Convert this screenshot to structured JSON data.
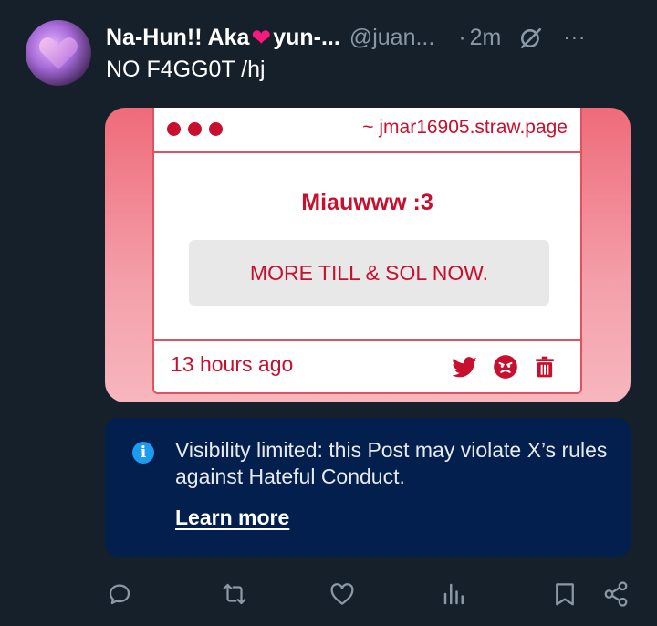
{
  "post": {
    "display_name": "Na-Hun!! Aka",
    "display_name_heart": "❤",
    "display_name_rest": "yun-...",
    "handle": "@juan...",
    "separator": "·",
    "time": "2m",
    "more": "···",
    "text": "NO F4GG0T /hj"
  },
  "card": {
    "url": "~ jmar16905.straw.page",
    "title": "Miauwww :3",
    "button_label": "MORE TILL & SOL NOW.",
    "timestamp": "13 hours ago",
    "colors": {
      "accent": "#c8102e",
      "border": "#e0525f",
      "bg": "#ef6b7a"
    }
  },
  "notice": {
    "icon": "info-icon",
    "icon_glyph": "i",
    "text": "Visibility limited: this Post may violate X’s rules against Hateful Conduct.",
    "link": "Learn more"
  },
  "actions": [
    "reply-icon",
    "repost-icon",
    "like-icon",
    "views-icon",
    "bookmark-icon",
    "share-icon"
  ],
  "colors": {
    "background": "#15202b",
    "muted": "#8b98a5",
    "notice_bg": "#031f4d",
    "info": "#1d9bf0"
  }
}
